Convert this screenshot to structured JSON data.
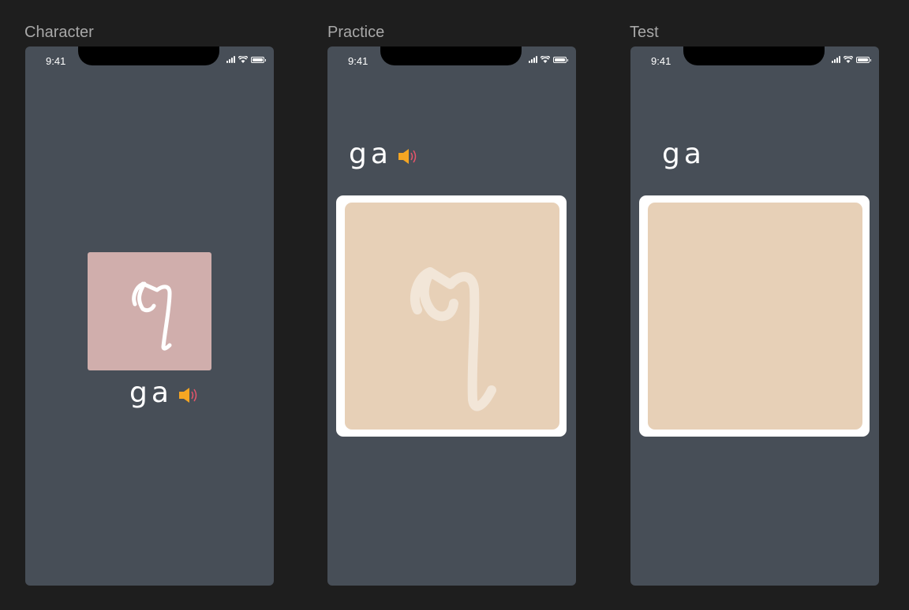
{
  "artboards": [
    {
      "label": "Character"
    },
    {
      "label": "Practice"
    },
    {
      "label": "Test"
    }
  ],
  "status_bar": {
    "time": "9:41"
  },
  "lesson": {
    "romanization": "ga",
    "character": "গ"
  },
  "colors": {
    "background": "#1e1e1e",
    "phone": "#474e57",
    "char_card": "#d0aeac",
    "canvas": "#e7d0b7",
    "speaker_body": "#f5a623",
    "speaker_waves": "#e8556b"
  },
  "icons": {
    "speaker": "speaker-sound-icon",
    "signal": "cellular-signal-icon",
    "wifi": "wifi-icon",
    "battery": "battery-icon"
  }
}
